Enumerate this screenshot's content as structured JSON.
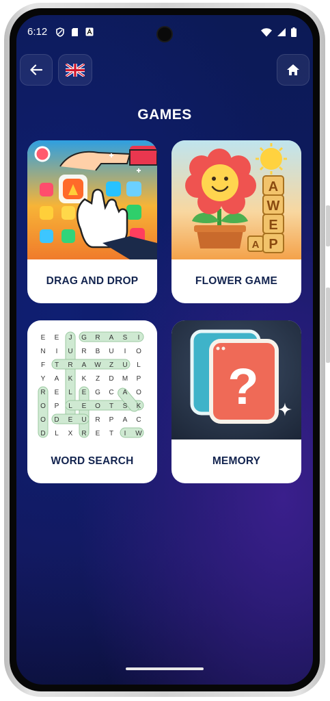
{
  "status_bar": {
    "time": "6:12",
    "left_icons": [
      "shield-icon",
      "sim-card-icon",
      "font-a-icon"
    ],
    "right_icons": [
      "wifi-icon",
      "signal-icon",
      "battery-icon"
    ]
  },
  "header": {
    "back_icon": "arrow-left-icon",
    "language_icon": "uk-flag-icon",
    "home_icon": "home-icon"
  },
  "page": {
    "title": "GAMES"
  },
  "games": [
    {
      "label": "DRAG AND DROP",
      "icon": "drag-and-drop-illustration"
    },
    {
      "label": "FLOWER GAME",
      "icon": "flower-game-illustration"
    },
    {
      "label": "WORD SEARCH",
      "icon": "word-search-illustration"
    },
    {
      "label": "MEMORY",
      "icon": "memory-cards-illustration"
    }
  ],
  "flower_art": {
    "letters": [
      "A",
      "W",
      "E",
      "P",
      "A"
    ]
  },
  "word_search_art": {
    "grid": [
      [
        "E",
        "E",
        "J",
        "G",
        "R",
        "A",
        "S",
        "I"
      ],
      [
        "N",
        "I",
        "U",
        "R",
        "B",
        "U",
        "I",
        "O"
      ],
      [
        "F",
        "T",
        "R",
        "A",
        "W",
        "Z",
        "U",
        "L"
      ],
      [
        "Y",
        "A",
        "K",
        "K",
        "Z",
        "D",
        "M",
        "P"
      ],
      [
        "R",
        "E",
        "L",
        "E",
        "G",
        "C",
        "A",
        "O"
      ],
      [
        "O",
        "P",
        "L",
        "E",
        "O",
        "T",
        "S",
        "K"
      ],
      [
        "O",
        "D",
        "E",
        "U",
        "R",
        "P",
        "A",
        "C"
      ],
      [
        "D",
        "L",
        "X",
        "R",
        "E",
        "T",
        "I",
        "W"
      ]
    ]
  },
  "memory_art": {
    "symbol": "?"
  },
  "colors": {
    "background": "#0e1a62",
    "card_label_text": "#13244f",
    "card_background": "#ffffff"
  }
}
